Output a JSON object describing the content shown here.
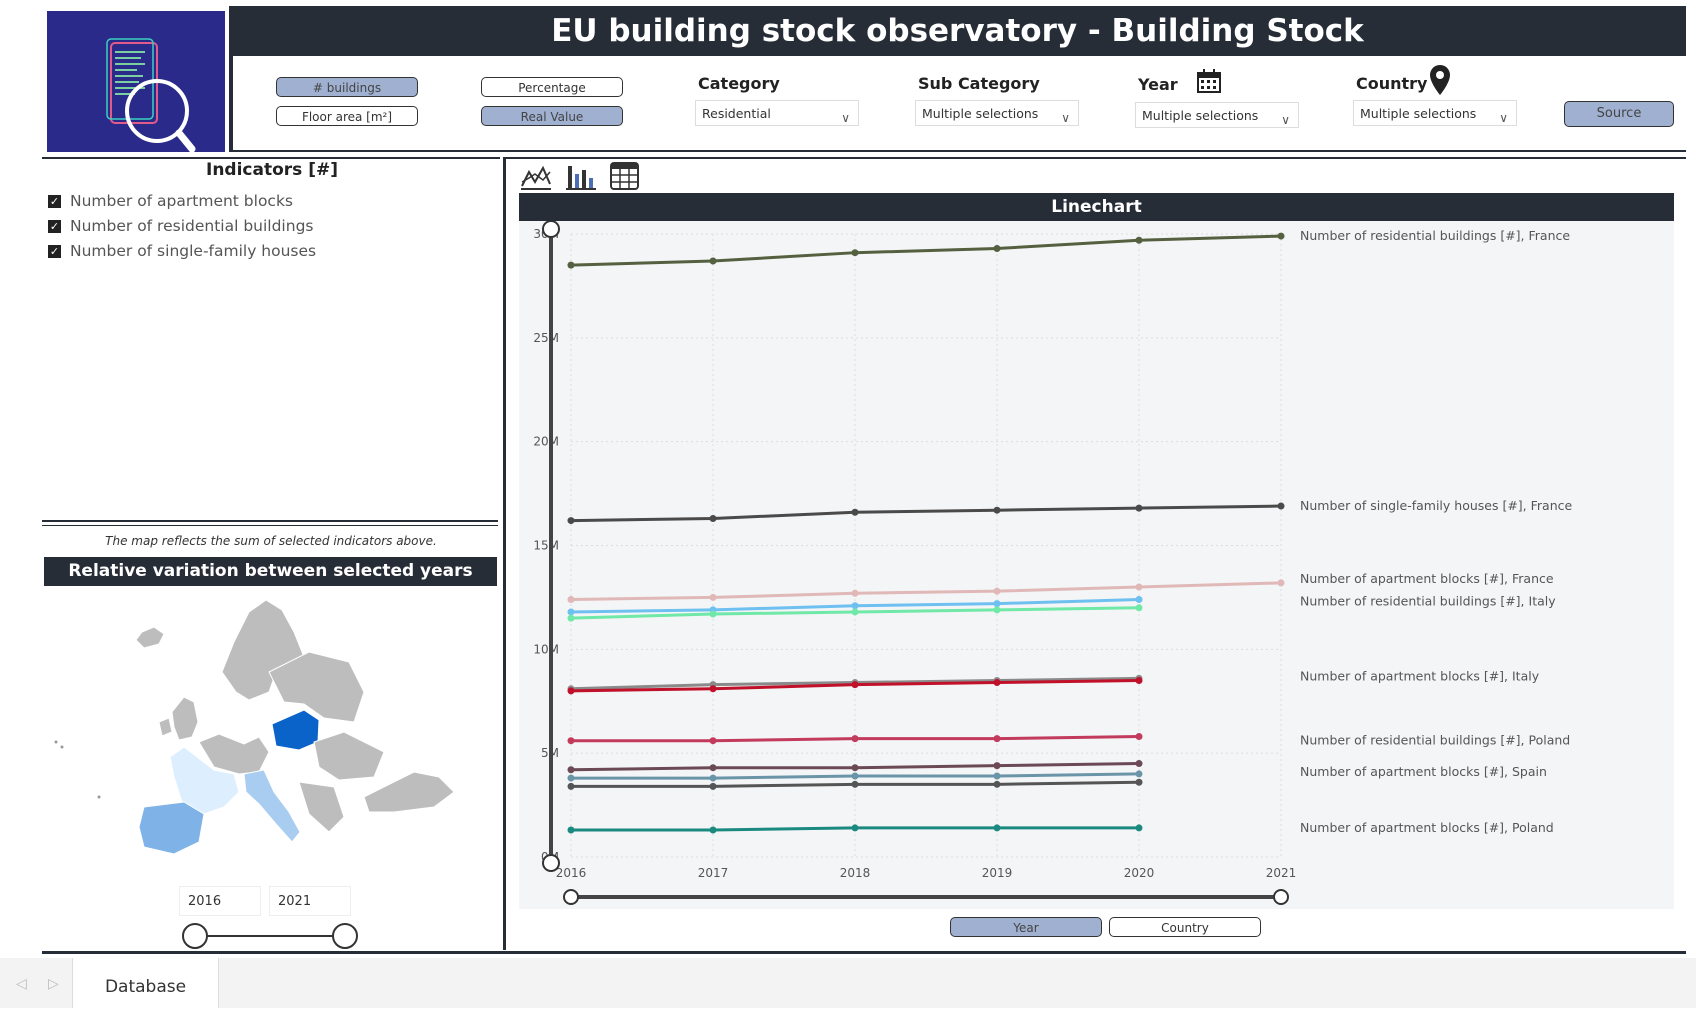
{
  "header": {
    "title": "EU building stock observatory - Building Stock"
  },
  "toggles": {
    "buildings_label": "# buildings",
    "floor_area_label": "Floor area [m²]",
    "percentage_label": "Percentage",
    "real_value_label": "Real Value"
  },
  "filters": {
    "category": {
      "label": "Category",
      "value": "Residential"
    },
    "subcategory": {
      "label": "Sub Category",
      "value": "Multiple selections"
    },
    "year": {
      "label": "Year",
      "value": "Multiple selections"
    },
    "country": {
      "label": "Country",
      "value": "Multiple selections"
    },
    "source_label": "Source"
  },
  "indicators": {
    "title": "Indicators [#]",
    "items": [
      {
        "label": "Number of apartment blocks",
        "checked": true
      },
      {
        "label": "Number of residential buildings",
        "checked": true
      },
      {
        "label": "Number of single-family houses",
        "checked": true
      }
    ]
  },
  "map": {
    "note": "The map reflects the sum of selected indicators above.",
    "title": "Relative variation between selected years",
    "year_from": "2016",
    "year_to": "2021"
  },
  "chart_header": {
    "title": "Linechart"
  },
  "axis_buttons": {
    "year_label": "Year",
    "country_label": "Country"
  },
  "tabs": {
    "database_label": "Database"
  },
  "colors": {
    "dark": "#262d37",
    "accent": "#9fb0d1",
    "map_blue": "#0a63c9"
  },
  "chart_data": {
    "type": "line",
    "title": "Linechart",
    "x": [
      2016,
      2017,
      2018,
      2019,
      2020,
      2021
    ],
    "ylim": [
      0,
      30
    ],
    "y_ticks": [
      "0M",
      "5M",
      "10M",
      "15M",
      "20M",
      "25M",
      "30M"
    ],
    "series": [
      {
        "name": "Number of residential buildings [#], France",
        "color": "#556040",
        "values": [
          28.5,
          28.7,
          29.1,
          29.3,
          29.7,
          29.9
        ]
      },
      {
        "name": "Number of single-family houses [#], France",
        "color": "#4a4a4a",
        "values": [
          16.2,
          16.3,
          16.6,
          16.7,
          16.8,
          16.9
        ]
      },
      {
        "name": "Number of apartment blocks [#], France",
        "color": "#e0b8b8",
        "values": [
          12.4,
          12.5,
          12.7,
          12.8,
          13.0,
          13.2
        ]
      },
      {
        "name": "Number of residential buildings [#], Italy",
        "color": "#6ec0f0",
        "values": [
          11.8,
          11.9,
          12.1,
          12.2,
          12.4,
          null
        ]
      },
      {
        "name": "",
        "color": "#6fe8a8",
        "values": [
          11.5,
          11.7,
          11.8,
          11.9,
          12.0,
          null
        ]
      },
      {
        "name": "",
        "color": "#8a8a8a",
        "values": [
          8.1,
          8.3,
          8.4,
          8.5,
          8.6,
          null
        ]
      },
      {
        "name": "Number of apartment blocks [#], Italy",
        "color": "#c0102a",
        "values": [
          8.0,
          8.1,
          8.3,
          8.4,
          8.5,
          null
        ]
      },
      {
        "name": "Number of residential buildings [#], Poland",
        "color": "#c23a5c",
        "values": [
          5.6,
          5.6,
          5.7,
          5.7,
          5.8,
          null
        ]
      },
      {
        "name": "",
        "color": "#6b4a55",
        "values": [
          4.2,
          4.3,
          4.3,
          4.4,
          4.5,
          null
        ]
      },
      {
        "name": "Number of apartment blocks [#], Spain",
        "color": "#6a95a8",
        "values": [
          3.8,
          3.8,
          3.9,
          3.9,
          4.0,
          null
        ]
      },
      {
        "name": "",
        "color": "#555555",
        "values": [
          3.4,
          3.4,
          3.5,
          3.5,
          3.6,
          null
        ]
      },
      {
        "name": "Number of apartment blocks [#], Poland",
        "color": "#1a8a80",
        "values": [
          1.3,
          1.3,
          1.4,
          1.4,
          1.4,
          null
        ]
      }
    ]
  }
}
